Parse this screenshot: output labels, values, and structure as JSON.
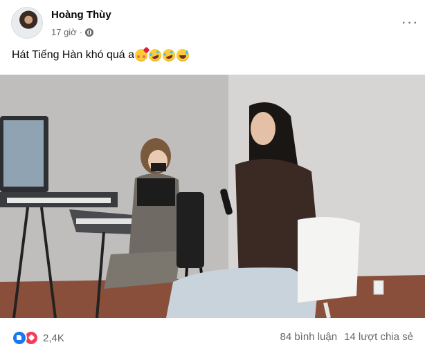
{
  "post": {
    "author": "Hoàng Thùy",
    "time": "17 giờ",
    "audience_icon": "globe-icon",
    "more_icon": "more-dots-icon",
    "more_label": "···",
    "caption": "Hát Tiếng Hàn khó quá a",
    "caption_emojis": [
      "smiling-face-with-hearts",
      "rofl",
      "rofl",
      "grinning-sweat"
    ]
  },
  "video": {
    "description_icon": "video-thumbnail"
  },
  "footer": {
    "reactions": [
      "like-reaction-icon",
      "love-reaction-icon"
    ],
    "reaction_count": "2,4K",
    "comments": "84 bình luận",
    "shares": "14 lượt chia sẻ"
  },
  "colors": {
    "secondary_text": "#65676b",
    "like_blue": "#1877f2",
    "love_red": "#f33e58"
  }
}
